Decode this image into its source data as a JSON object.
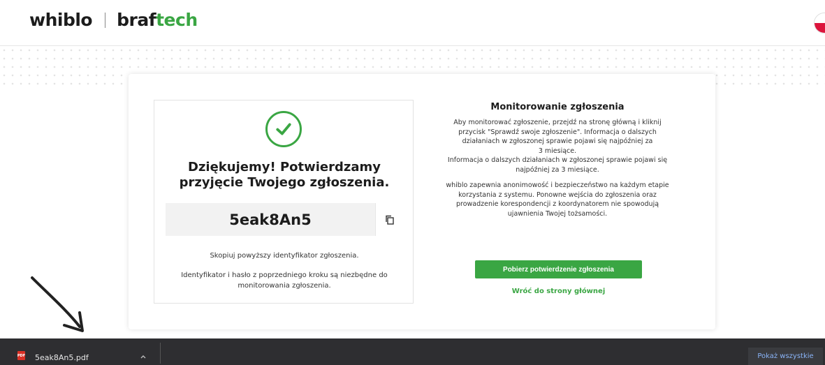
{
  "header": {
    "logo_primary": "whiblo",
    "logo_secondary_prefix": "braf",
    "logo_secondary_suffix": "tech",
    "lang_flag": "poland-flag-icon"
  },
  "confirmation": {
    "title_line1": "Dziękujemy! Potwierdzamy",
    "title_line2": "przyjęcie Twojego zgłoszenia.",
    "report_id": "5eak8An5",
    "copy_hint": "Skopiuj powyższy identyfikator zgłoszenia.",
    "id_note": "Identyfikator i hasło z poprzedniego kroku są niezbędne do monitorowania zgłoszenia."
  },
  "monitoring": {
    "title": "Monitorowanie zgłoszenia",
    "para1_line1": "Aby monitorować zgłoszenie, przejdź na stronę główną i kliknij",
    "para1_line2": "przycisk \"Sprawdź swoje zgłoszenie\". Informacja o dalszych",
    "para1_line3": "działaniach w zgłoszonej sprawie pojawi się najpóźniej za",
    "para1_line4": "3 miesiące.",
    "para1_line5": "Informacja o dalszych działaniach w zgłoszonej sprawie pojawi się",
    "para1_line6": "najpóźniej za 3 miesiące.",
    "para2_line1": "whiblo zapewnia anonimowość i bezpieczeństwo na każdym etapie",
    "para2_line2": "korzystania z systemu. Ponowne wejścia do zgłoszenia oraz",
    "para2_line3": "prowadzenie korespondencji z koordynatorem nie spowodują",
    "para2_line4": "ujawnienia Twojej tożsamości.",
    "download_button": "Pobierz potwierdzenie zgłoszenia",
    "back_link": "Wróć do strony głównej"
  },
  "download_bar": {
    "file_name": "5eak8An5.pdf",
    "file_icon_text": "PDF",
    "show_all": "Pokaż wszystkie"
  },
  "colors": {
    "accent": "#3aa643",
    "download_bar_bg": "#2e2e31",
    "show_all_text": "#8ab4f8"
  }
}
